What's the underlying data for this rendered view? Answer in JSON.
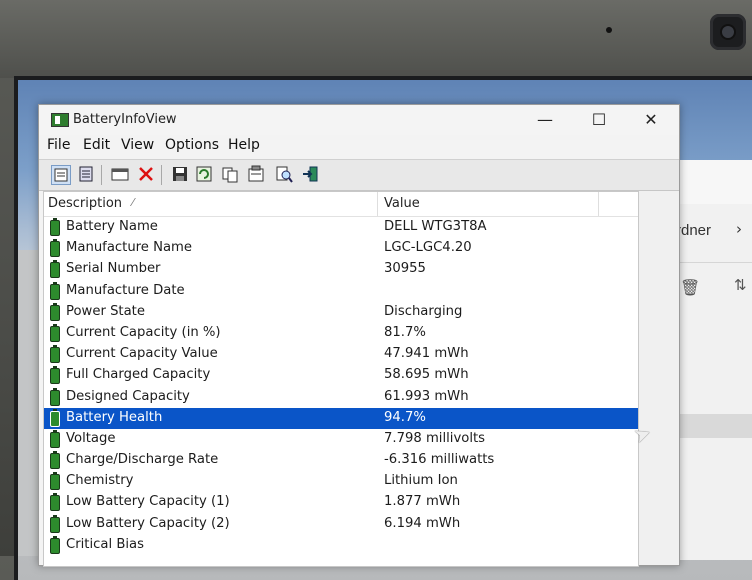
{
  "window": {
    "title": "BatteryInfoView",
    "controls": {
      "minimize": "—",
      "maximize": "☐",
      "close": "✕"
    }
  },
  "menu": [
    "File",
    "Edit",
    "View",
    "Options",
    "Help"
  ],
  "toolbar": [
    "properties-icon",
    "report-icon",
    "window-icon",
    "delete-icon",
    "save-icon",
    "refresh-icon",
    "copy-icon",
    "html-report-icon",
    "find-icon",
    "exit-icon"
  ],
  "columns": {
    "description": "Description",
    "value": "Value"
  },
  "rows": [
    {
      "description": "Battery Name",
      "value": "DELL WTG3T8A"
    },
    {
      "description": "Manufacture Name",
      "value": "LGC-LGC4.20"
    },
    {
      "description": "Serial Number",
      "value": "30955"
    },
    {
      "description": "Manufacture Date",
      "value": ""
    },
    {
      "description": "Power State",
      "value": "Discharging"
    },
    {
      "description": "Current Capacity (in %)",
      "value": "81.7%"
    },
    {
      "description": "Current Capacity Value",
      "value": "47.941 mWh"
    },
    {
      "description": "Full Charged Capacity",
      "value": "58.695 mWh"
    },
    {
      "description": "Designed Capacity",
      "value": "61.993 mWh"
    },
    {
      "description": "Battery Health",
      "value": "94.7%",
      "selected": true
    },
    {
      "description": "Voltage",
      "value": "7.798 millivolts"
    },
    {
      "description": "Charge/Discharge Rate",
      "value": "-6.316 milliwatts"
    },
    {
      "description": "Chemistry",
      "value": "Lithium Ion"
    },
    {
      "description": "Low Battery Capacity (1)",
      "value": "1.877 mWh"
    },
    {
      "description": "Low Battery Capacity (2)",
      "value": "6.194 mWh"
    },
    {
      "description": "Critical Bias",
      "value": ""
    }
  ],
  "background_explorer": {
    "ordner_text": "rdner",
    "chevron": "›"
  },
  "colors": {
    "selection": "#0a55c8",
    "battery_icon": "#2d8b2d"
  }
}
